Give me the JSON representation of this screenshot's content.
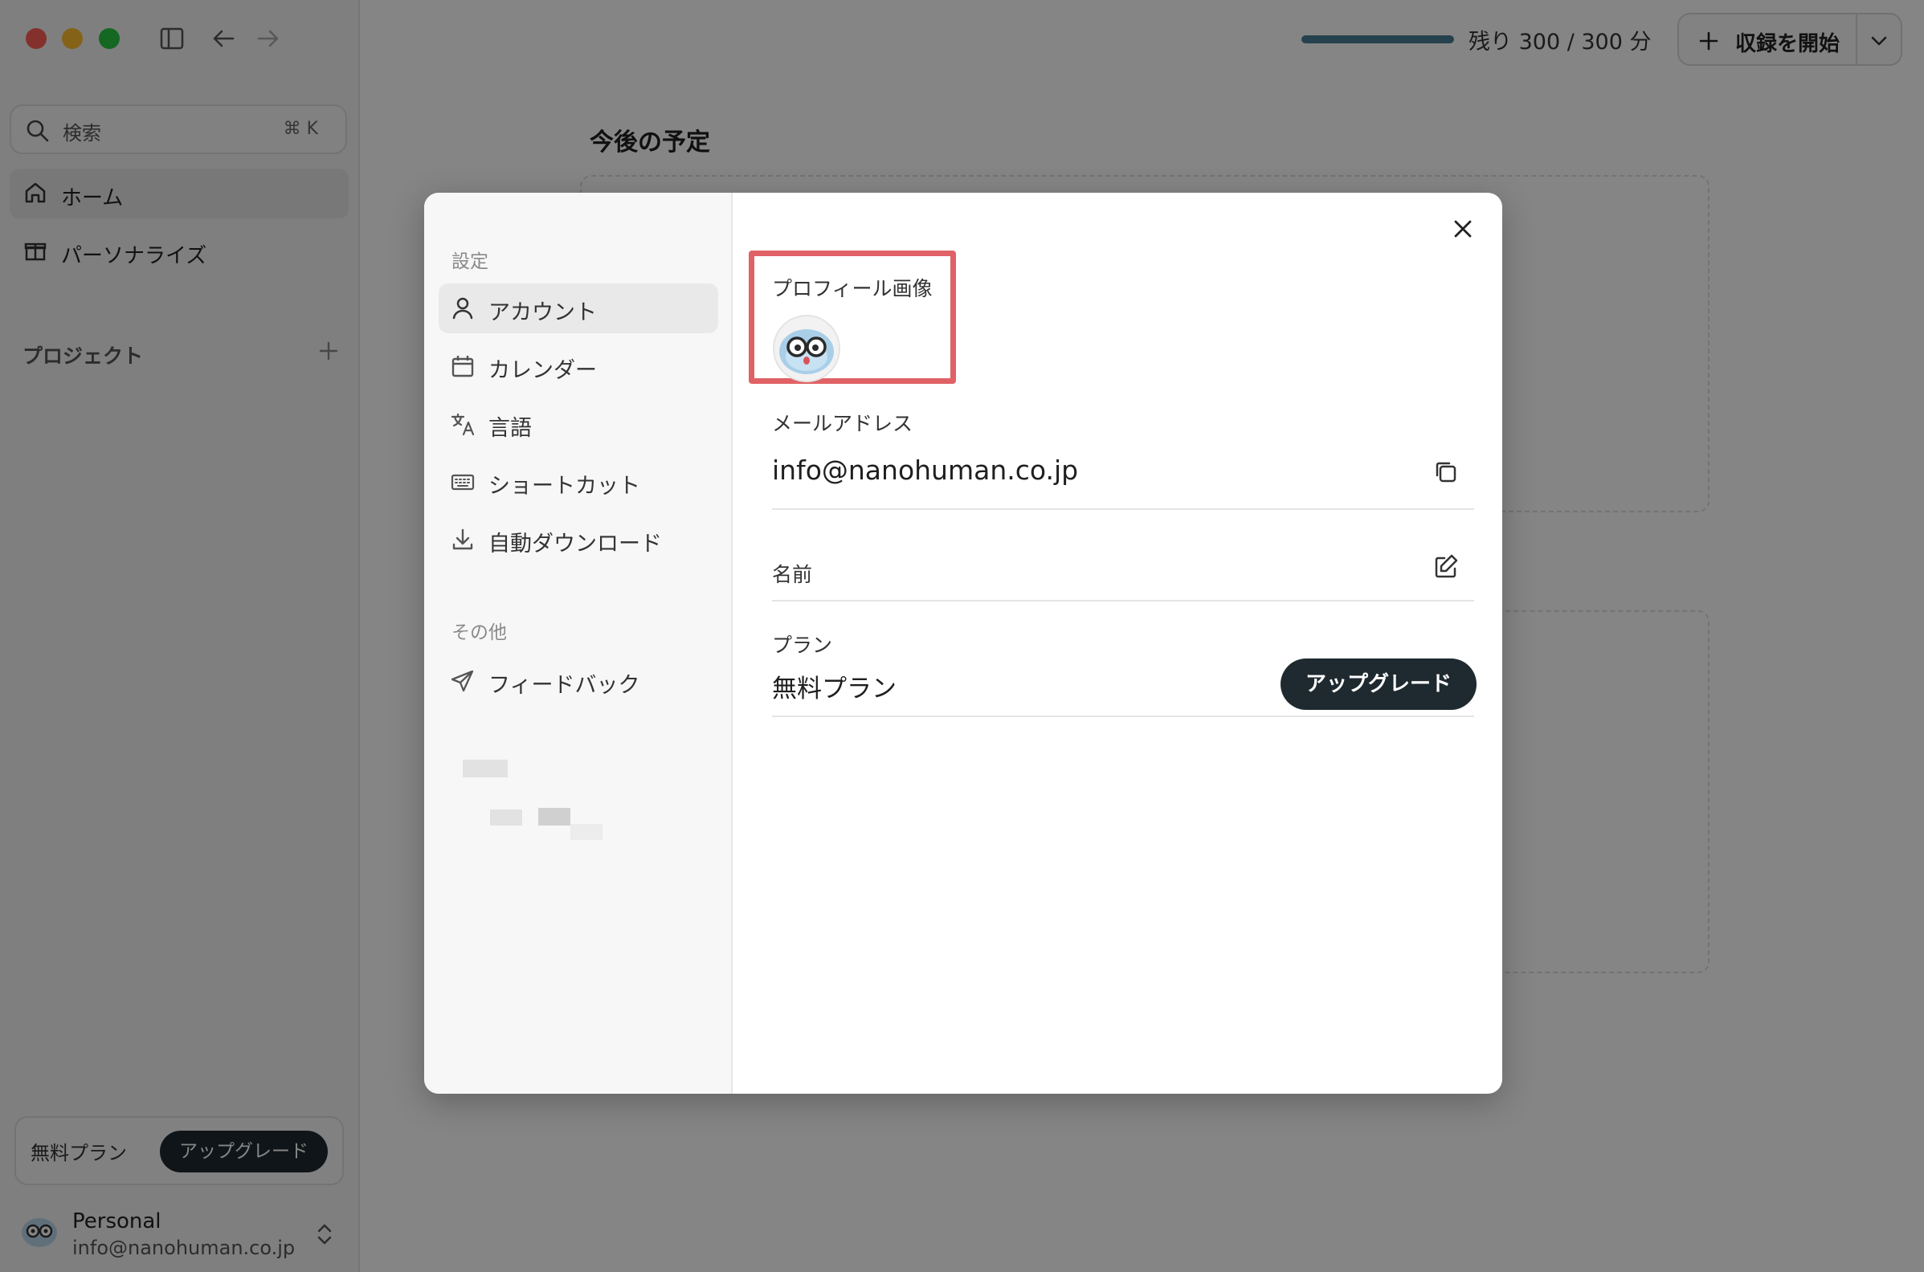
{
  "topbar": {
    "remaining": "残り 300 / 300 分",
    "start_recording": "収録を開始"
  },
  "sidebar": {
    "search_label": "検索",
    "search_shortcut": "⌘ K",
    "items": [
      {
        "label": "ホーム",
        "icon": "home-icon"
      },
      {
        "label": "パーソナライズ",
        "icon": "gift-icon"
      }
    ],
    "projects_label": "プロジェクト",
    "plan_name": "無料プラン",
    "upgrade_label": "アップグレード",
    "user_name": "Personal",
    "user_email": "info@nanohuman.co.jp"
  },
  "main": {
    "title": "今後の予定"
  },
  "modal": {
    "section_settings": "設定",
    "nav": [
      {
        "label": "アカウント",
        "icon": "user-icon",
        "active": true
      },
      {
        "label": "カレンダー",
        "icon": "calendar-icon",
        "active": false
      },
      {
        "label": "言語",
        "icon": "translate-icon",
        "active": false
      },
      {
        "label": "ショートカット",
        "icon": "keyboard-icon",
        "active": false
      },
      {
        "label": "自動ダウンロード",
        "icon": "download-icon",
        "active": false
      }
    ],
    "section_other": "その他",
    "feedback_label": "フィードバック",
    "profile_image_label": "プロフィール画像",
    "email_label": "メールアドレス",
    "email_value": "info@nanohuman.co.jp",
    "name_label": "名前",
    "plan_label": "プラン",
    "plan_value": "無料プラン",
    "upgrade_label": "アップグレード"
  },
  "colors": {
    "highlight": "#e06266",
    "dark_button": "#1f2a30",
    "progress": "#4a7e96"
  }
}
